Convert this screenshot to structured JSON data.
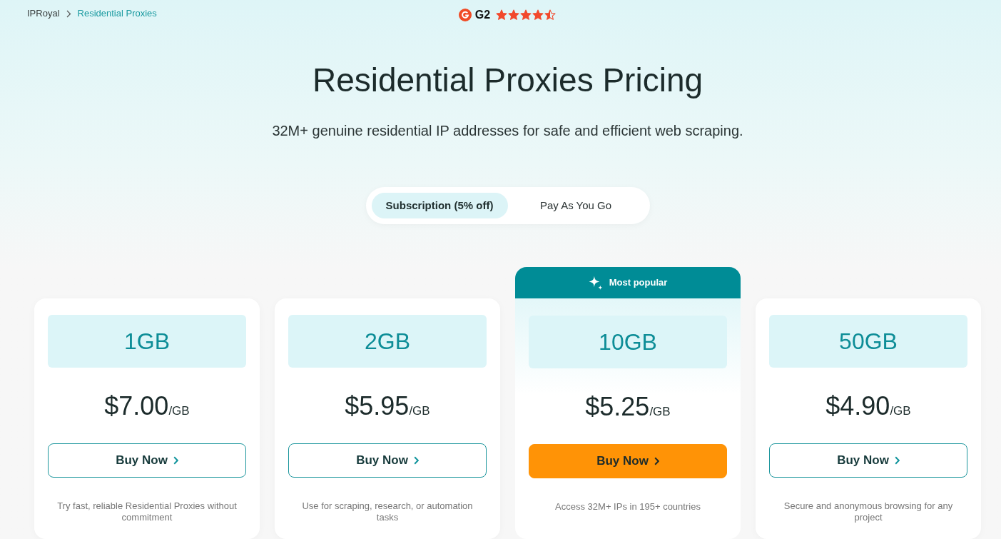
{
  "breadcrumb": [
    {
      "label": "IPRoyal",
      "current": false
    },
    {
      "label": "Residential Proxies",
      "current": true
    }
  ],
  "rating": {
    "brand": "G2",
    "stars": 4.5
  },
  "title": "Residential Proxies Pricing",
  "subtitle": "32M+ genuine residential IP addresses for safe and efficient web scraping.",
  "billing_tabs": [
    {
      "label": "Subscription (5% off)",
      "selected": true
    },
    {
      "label": "Pay As You Go",
      "selected": false
    }
  ],
  "plans": [
    {
      "size": "1GB",
      "price": "$7.00",
      "unit": "/GB",
      "button": "Buy Now",
      "highlighted": false,
      "description": "Try fast, reliable Residential Proxies without commitment"
    },
    {
      "size": "2GB",
      "price": "$5.95",
      "unit": "/GB",
      "button": "Buy Now",
      "highlighted": false,
      "description": "Use for scraping, research, or automation tasks"
    },
    {
      "badge": "Most popular",
      "size": "10GB",
      "price": "$5.25",
      "unit": "/GB",
      "button": "Buy Now",
      "highlighted": true,
      "description": "Access 32M+ IPs in 195+ countries"
    },
    {
      "size": "50GB",
      "price": "$4.90",
      "unit": "/GB",
      "button": "Buy Now",
      "highlighted": false,
      "description": "Secure and anonymous browsing for any project"
    }
  ]
}
